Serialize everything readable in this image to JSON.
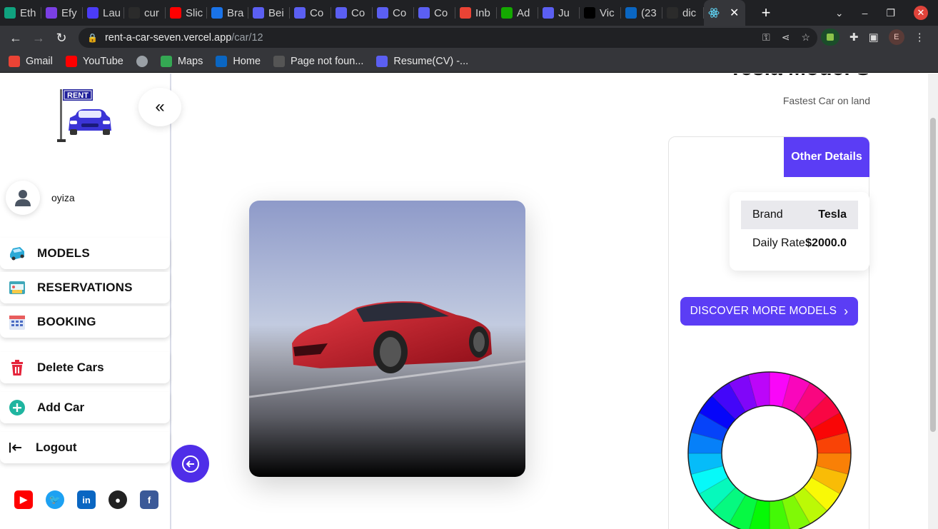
{
  "browser": {
    "tabs": [
      {
        "label": "Eth",
        "icon": "chatgpt-icon",
        "color": "#10a37f"
      },
      {
        "label": "Efy",
        "icon": "efy-icon",
        "color": "#7b3fe4"
      },
      {
        "label": "Lau",
        "icon": "zoho-icon",
        "color": "#4b3cf7"
      },
      {
        "label": "cur",
        "icon": "github-icon",
        "color": "#2b2b2b"
      },
      {
        "label": "Slic",
        "icon": "youtube-icon",
        "color": "#ff0000"
      },
      {
        "label": "Bra",
        "icon": "brave-icon",
        "color": "#1a73e8"
      },
      {
        "label": "Bei",
        "icon": "docs-icon",
        "color": "#5b5ff2"
      },
      {
        "label": "Co",
        "icon": "docs-icon",
        "color": "#5b5ff2"
      },
      {
        "label": "Co",
        "icon": "docs-icon",
        "color": "#5b5ff2"
      },
      {
        "label": "Co",
        "icon": "docs-icon",
        "color": "#5b5ff2"
      },
      {
        "label": "Co",
        "icon": "docs-icon",
        "color": "#5b5ff2"
      },
      {
        "label": "Inb",
        "icon": "gmail-icon",
        "color": "#ea4335"
      },
      {
        "label": "Ad",
        "icon": "upwork-icon",
        "color": "#14a800"
      },
      {
        "label": "Ju",
        "icon": "docs-icon",
        "color": "#5b5ff2"
      },
      {
        "label": "Vic",
        "icon": "medium-icon",
        "color": "#000000"
      },
      {
        "label": "(23",
        "icon": "linkedin-icon",
        "color": "#0a66c2"
      },
      {
        "label": "dic",
        "icon": "github-icon",
        "color": "#2b2b2b"
      }
    ],
    "active_tab_icon": "react-icon",
    "url_host": "rent-a-car-seven.vercel.app",
    "url_path": "/car/12",
    "profile_initial": "E",
    "bookmarks": [
      {
        "label": "Gmail",
        "icon": "gmail-icon",
        "color": "#ea4335"
      },
      {
        "label": "YouTube",
        "icon": "youtube-icon",
        "color": "#ff0000"
      },
      {
        "label": "",
        "icon": "globe-icon",
        "color": "#9aa0a6"
      },
      {
        "label": "Maps",
        "icon": "maps-icon",
        "color": "#34a853"
      },
      {
        "label": "Home",
        "icon": "linkedin-icon",
        "color": "#0a66c2"
      },
      {
        "label": "Page not foun...",
        "icon": "github-icon",
        "color": "#555"
      },
      {
        "label": "Resume(CV) -...",
        "icon": "docs-icon",
        "color": "#5b5ff2"
      }
    ]
  },
  "sidebar": {
    "logo_text": "RENT",
    "user_name": "oyiza",
    "items": [
      {
        "label": "MODELS",
        "icon": "car-icon"
      },
      {
        "label": "RESERVATIONS",
        "icon": "reservation-icon"
      },
      {
        "label": "BOOKING",
        "icon": "calendar-icon"
      },
      {
        "label": "Delete Cars",
        "icon": "trash-icon"
      },
      {
        "label": "Add Car",
        "icon": "plus-circle-icon"
      },
      {
        "label": "Logout",
        "icon": "logout-icon"
      }
    ],
    "social": [
      {
        "name": "youtube-icon",
        "color": "#ff0000"
      },
      {
        "name": "twitter-icon",
        "color": "#1da1f2"
      },
      {
        "name": "linkedin-icon",
        "color": "#0a66c2"
      },
      {
        "name": "github-icon",
        "color": "#222222"
      },
      {
        "name": "facebook-icon",
        "color": "#3b5998"
      }
    ]
  },
  "car": {
    "title": "Tesla Model S",
    "subtitle": "Fastest Car on land",
    "details_header": "Other Details",
    "details": [
      {
        "label": "Brand",
        "value": "Tesla"
      },
      {
        "label": "Daily Rate",
        "value": "$2000.0"
      }
    ],
    "discover_label": "DISCOVER MORE MODELS"
  },
  "colors": {
    "accent": "#5b3df5",
    "back_button": "#4f2ee8"
  }
}
